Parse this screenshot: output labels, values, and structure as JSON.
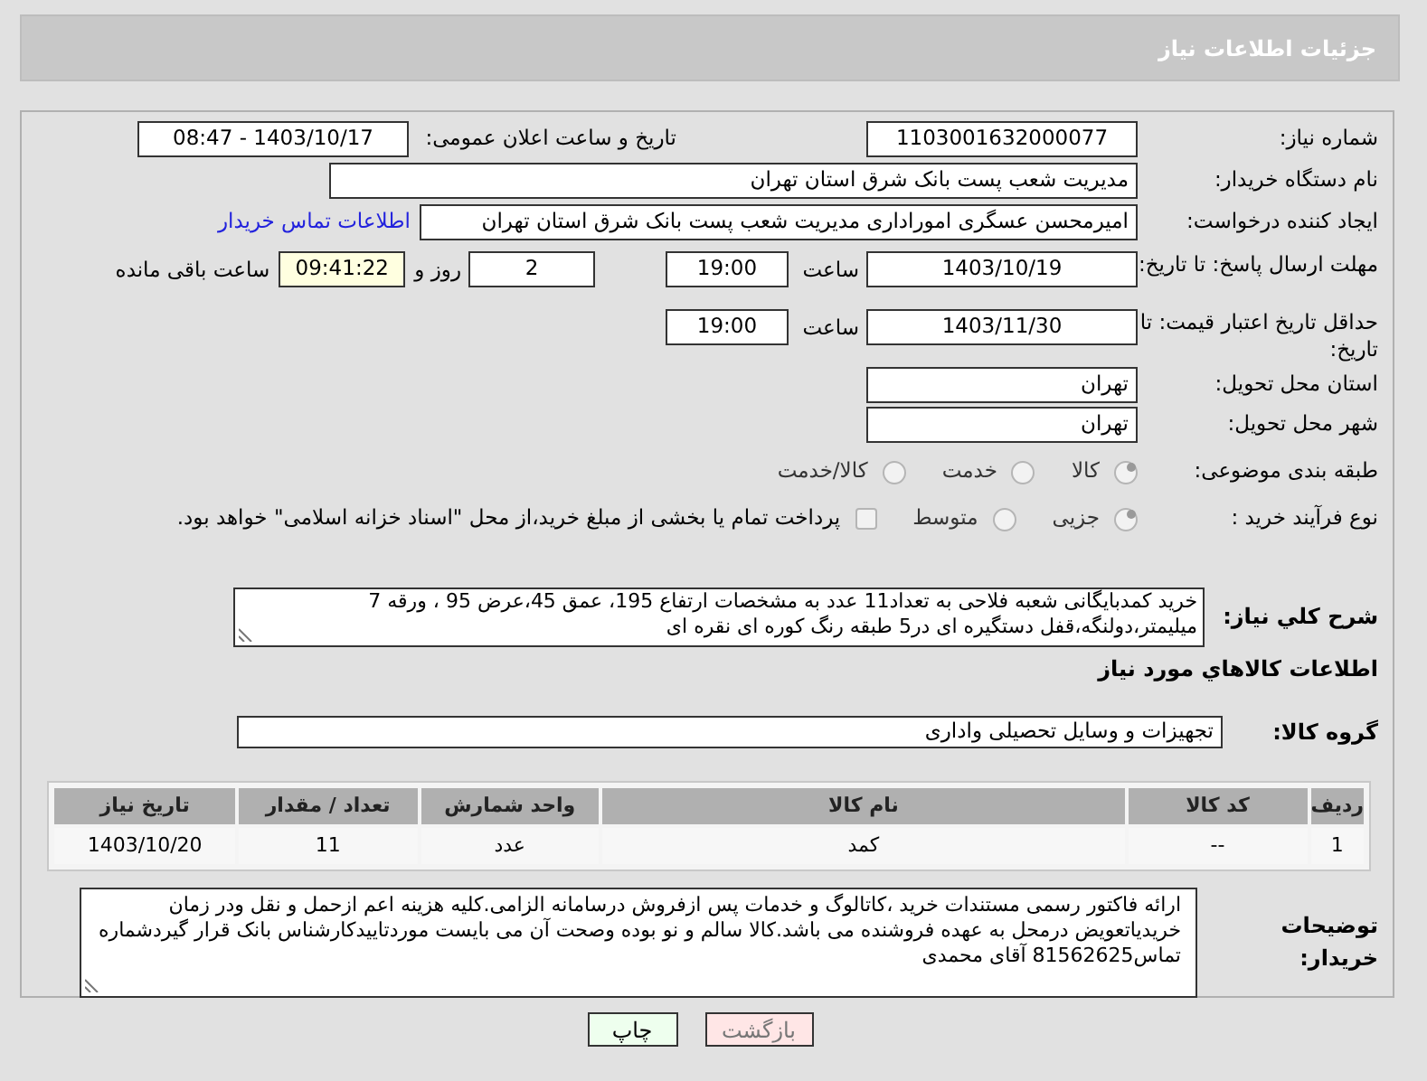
{
  "header": {
    "title": "جزئیات اطلاعات نیاز"
  },
  "need_number": {
    "label": "شماره نیاز:",
    "value": "1103001632000077"
  },
  "announce": {
    "label": "تاریخ و ساعت اعلان عمومی:",
    "value": "1403/10/17 - 08:47"
  },
  "buyer_org": {
    "label": "نام دستگاه خریدار:",
    "value": "مدیریت شعب پست بانک شرق استان تهران"
  },
  "requester": {
    "label": "ایجاد کننده درخواست:",
    "value": "امیرمحسن عسگری امورادارى مدیریت شعب پست بانک شرق استان تهران",
    "link": "اطلاعات تماس خریدار"
  },
  "deadline": {
    "label": "مهلت ارسال پاسخ: تا تاریخ:",
    "date": "1403/10/19",
    "time_label": "ساعت",
    "time": "19:00",
    "days": "2",
    "days_label": "روز و",
    "remaining": "09:41:22",
    "remaining_label": "ساعت باقی مانده"
  },
  "validity": {
    "label": "حداقل تاریخ اعتبار قیمت: تا تاریخ:",
    "date": "1403/11/30",
    "time_label": "ساعت",
    "time": "19:00"
  },
  "province": {
    "label": "استان محل تحویل:",
    "value": "تهران"
  },
  "city": {
    "label": "شهر محل تحویل:",
    "value": "تهران"
  },
  "category": {
    "label": "طبقه بندی موضوعی:",
    "options": [
      {
        "label": "کالا",
        "selected": true
      },
      {
        "label": "خدمت",
        "selected": false
      },
      {
        "label": "کالا/خدمت",
        "selected": false
      }
    ]
  },
  "process": {
    "label": "نوع فرآیند خرید :",
    "options": [
      {
        "label": "جزیی",
        "selected": true
      },
      {
        "label": "متوسط",
        "selected": false
      }
    ],
    "treasury": {
      "label": "پرداخت تمام یا بخشی از مبلغ خرید،از محل \"اسناد خزانه اسلامی\" خواهد بود.",
      "checked": false
    }
  },
  "description": {
    "label": "شرح کلي نياز:",
    "value": "خرید کمدبایگانی شعبه فلاحی به تعداد11 عدد به مشخصات ارتفاع 195، عمق 45،عرض 95 ، ورقه 7 میلیمتر،دولنگه،قفل دستگیره ای در5 طبقه رنگ کوره ای نقره ای"
  },
  "goods_heading": "اطلاعات كالاهاي مورد نياز",
  "goods_group": {
    "label": "گروه کالا:",
    "value": "تجهیزات و وسایل تحصیلی واداری"
  },
  "table": {
    "columns": [
      "ردیف",
      "کد کالا",
      "نام کالا",
      "واحد شمارش",
      "تعداد / مقدار",
      "تاریخ نیاز"
    ],
    "rows": [
      [
        "1",
        "--",
        "کمد",
        "عدد",
        "11",
        "1403/10/20"
      ]
    ]
  },
  "buyer_notes": {
    "label": "توضیحات خریدار:",
    "value": "ارائه فاکتور رسمی مستندات خرید ،کاتالوگ و خدمات پس ازفروش درسامانه الزامی.کلیه هزینه اعم ازحمل و نقل ودر زمان خریدیاتعویض درمحل به عهده فروشنده می باشد.کالا سالم و نو بوده وصحت آن می بایست موردتاییدکارشناس بانک قرار گیردشماره تماس81562625 آقای محمدی"
  },
  "buttons": [
    {
      "kind": "back",
      "label": "بازگشت"
    },
    {
      "kind": "print",
      "label": "چاپ"
    }
  ]
}
